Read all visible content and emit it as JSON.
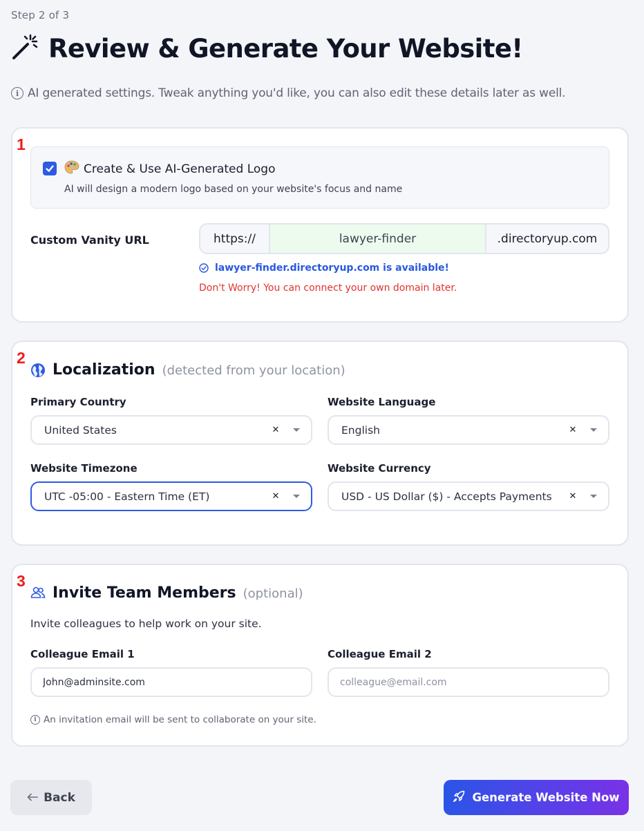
{
  "header": {
    "step": "Step 2 of 3",
    "title": "Review & Generate Your Website!",
    "subtitle": "AI generated settings. Tweak anything you'd like, you can also edit these details later as well."
  },
  "section1": {
    "number": "1",
    "logo_title": "Create & Use AI-Generated Logo",
    "logo_desc": "AI will design a modern logo based on your website's focus and name",
    "logo_checked": true,
    "vanity_label": "Custom Vanity URL",
    "url_prefix": "https://",
    "url_value": "lawyer-finder",
    "url_suffix": ".directoryup.com",
    "available_msg": "lawyer-finder.directoryup.com is available!",
    "worry_msg": "Don't Worry! You can connect your own domain later."
  },
  "section2": {
    "number": "2",
    "title": "Localization",
    "note": "(detected from your location)",
    "country_label": "Primary Country",
    "country_value": "United States",
    "language_label": "Website Language",
    "language_value": "English",
    "timezone_label": "Website Timezone",
    "timezone_value": "UTC -05:00 - Eastern Time (ET)",
    "currency_label": "Website Currency",
    "currency_value": "USD - US Dollar ($) - Accepts Payments"
  },
  "section3": {
    "number": "3",
    "title": "Invite Team Members",
    "note": "(optional)",
    "description": "Invite colleagues to help work on your site.",
    "email1_label": "Colleague Email 1",
    "email1_value": "John@adminsite.com",
    "email2_label": "Colleague Email 2",
    "email2_placeholder": "colleague@email.com",
    "footer_note": "An invitation email will be sent to collaborate on your site."
  },
  "footer": {
    "back_label": "Back",
    "generate_label": "Generate Website Now"
  },
  "colors": {
    "primary": "#2d5be3",
    "error": "#e0332e",
    "number": "#ee1d1d",
    "available_bg": "#edfbef"
  },
  "icons": [
    "magic-wand-icon",
    "info-icon",
    "palette-icon",
    "check-icon",
    "check-circle-icon",
    "globe-icon",
    "team-icon",
    "clear-icon",
    "chevron-down-icon",
    "arrow-left-icon",
    "rocket-icon"
  ]
}
